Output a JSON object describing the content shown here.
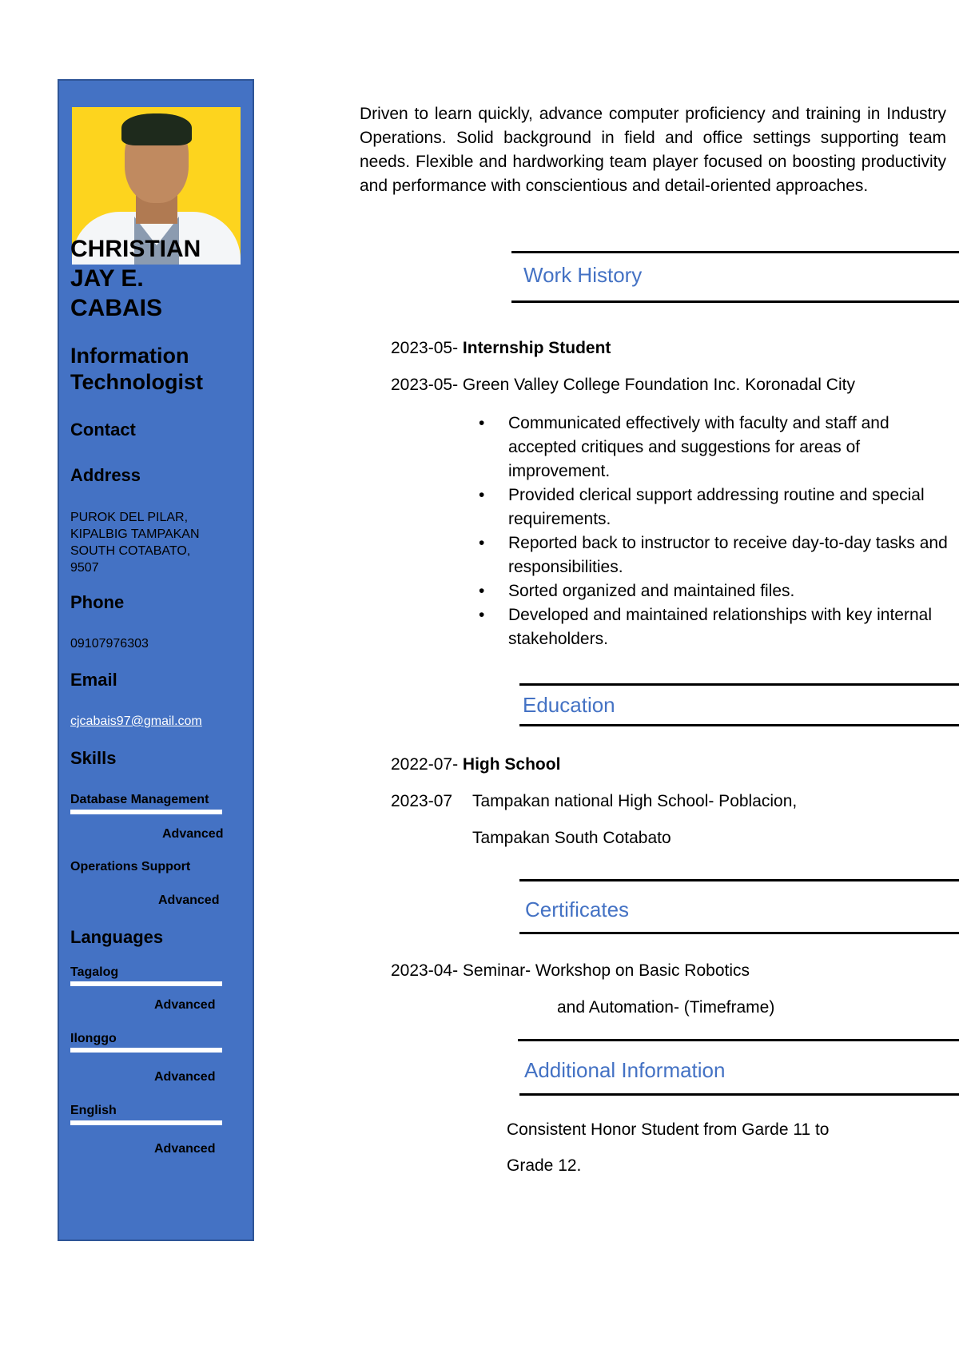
{
  "sidebar": {
    "name_lines": [
      "CHRISTIAN",
      "JAY E.",
      "CABAIS"
    ],
    "title_lines": [
      "Information",
      "Technologist"
    ],
    "contact_heading": "Contact",
    "address_heading": "Address",
    "address_lines": [
      "PUROK DEL PILAR,",
      "KIPALBIG TAMPAKAN",
      "SOUTH COTABATO,",
      "9507"
    ],
    "phone_heading": "Phone",
    "phone": "09107976303",
    "email_heading": "Email",
    "email": "cjcabais97@gmail.com",
    "skills_heading": "Skills",
    "skills": [
      {
        "name": "Database Management",
        "level": "Advanced",
        "proficiency": 1.0
      },
      {
        "name": "Operations Support",
        "level": "Advanced"
      }
    ],
    "languages_heading": "Languages",
    "languages": [
      {
        "name": "Tagalog",
        "level": "Advanced",
        "proficiency": 1.0
      },
      {
        "name": "Ilonggo",
        "level": "Advanced",
        "proficiency": 1.0
      },
      {
        "name": "English",
        "level": "Advanced",
        "proficiency": 1.0
      }
    ]
  },
  "main": {
    "summary": "Driven to learn quickly, advance computer proficiency and training in Industry Operations. Solid background in field and office settings supporting team needs. Flexible and hardworking team player focused on boosting productivity and performance with conscientious and detail-oriented approaches.",
    "work_history": {
      "heading": "Work History",
      "date_start": "2023-05-",
      "role": "Internship Student",
      "date_end": "2023-05-",
      "organization": "Green Valley College Foundation Inc. Koronadal City",
      "bullets": [
        "Communicated effectively with faculty and staff and accepted critiques and suggestions for areas of improvement.",
        "Provided clerical support addressing routine and special requirements.",
        "Reported back to instructor to receive day-to-day tasks and responsibilities.",
        "Sorted organized and maintained files.",
        "Developed and maintained relationships with key internal stakeholders."
      ]
    },
    "education": {
      "heading": "Education",
      "date_start": "2022-07-",
      "degree": "High School",
      "date_end": "2023-07",
      "school_line1": "Tampakan national High School- Poblacion,",
      "school_line2": "Tampakan South Cotabato"
    },
    "certificates": {
      "heading": "Certificates",
      "date": "2023-04-",
      "line1": "Seminar- Workshop on Basic Robotics",
      "line2": "and Automation- (Timeframe)"
    },
    "additional": {
      "heading": "Additional Information",
      "line1": "Consistent Honor Student from Garde 11 to",
      "line2": "Grade 12."
    }
  },
  "colors": {
    "sidebar": "#4472c4",
    "photo_background": "#fdd41e",
    "section_heading": "#4472c4"
  }
}
